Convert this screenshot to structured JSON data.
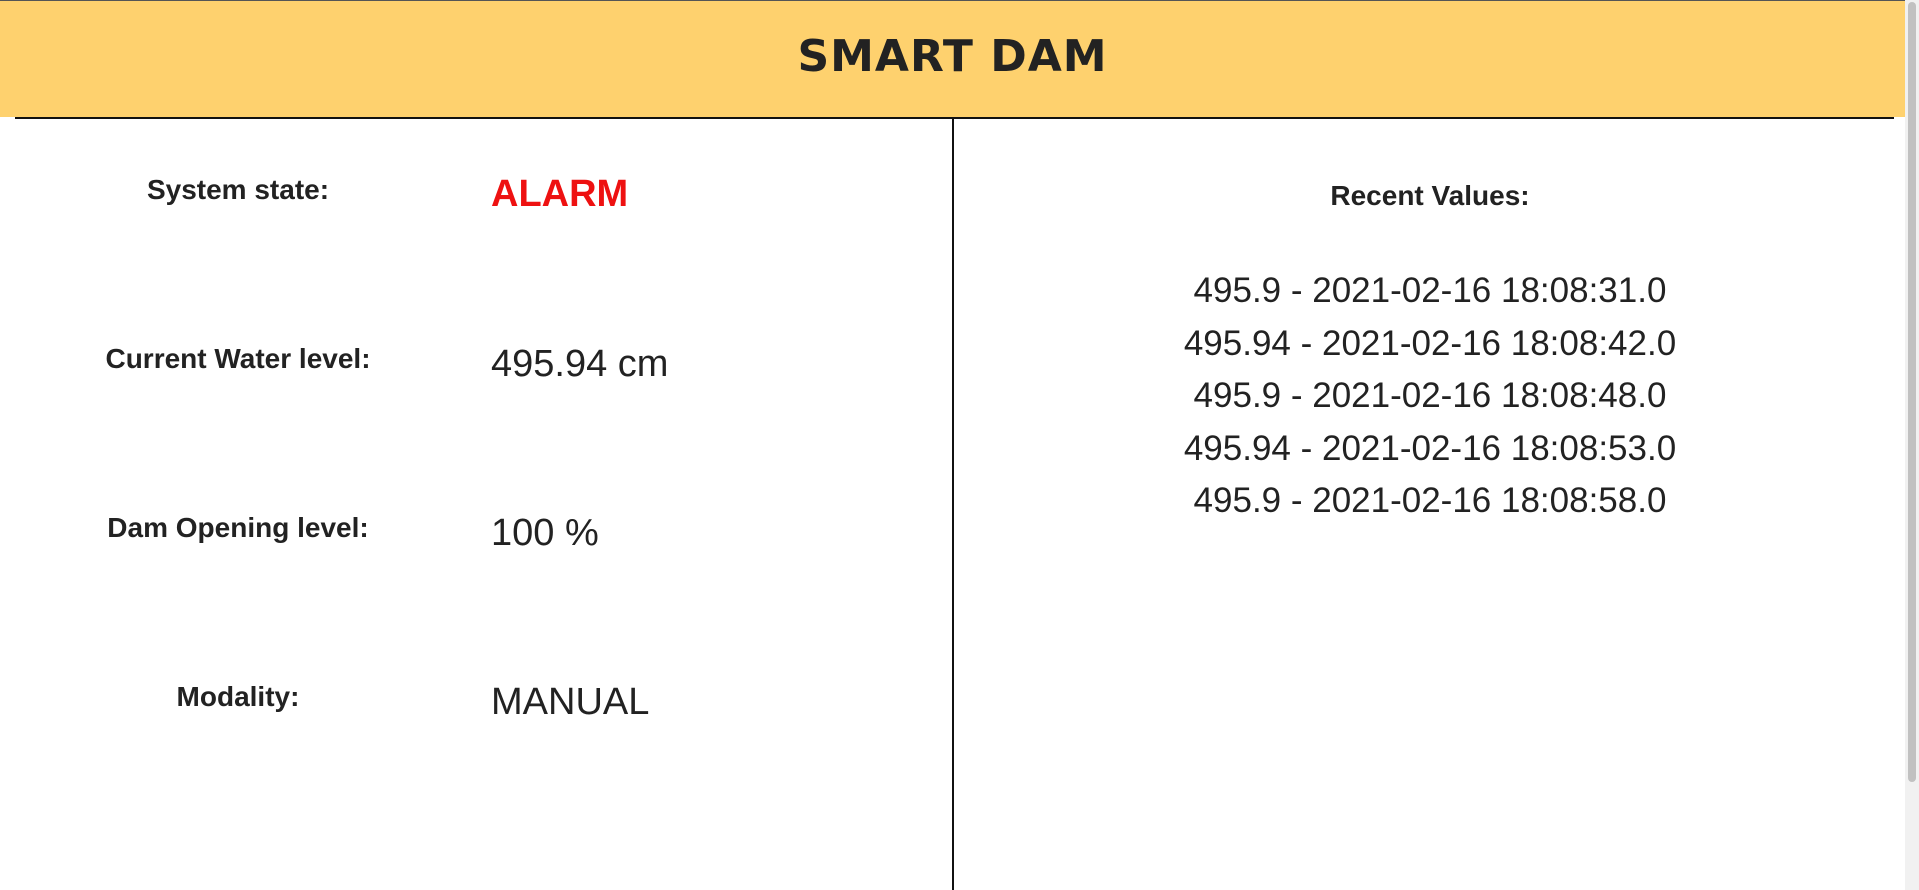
{
  "header": {
    "title": "SMART DAM"
  },
  "status": {
    "system_state_label": "System state:",
    "system_state_value": "ALARM",
    "water_level_label": "Current Water level:",
    "water_level_value": "495.94 cm",
    "dam_opening_label": "Dam Opening level:",
    "dam_opening_value": "100 %",
    "modality_label": "Modality:",
    "modality_value": "MANUAL"
  },
  "recent": {
    "title": "Recent Values:",
    "items": [
      "495.9 - 2021-02-16 18:08:31.0",
      "495.94 - 2021-02-16 18:08:42.0",
      "495.9 - 2021-02-16 18:08:48.0",
      "495.94 - 2021-02-16 18:08:53.0",
      "495.9 - 2021-02-16 18:08:58.0"
    ]
  },
  "colors": {
    "header_bg": "#fed16e",
    "alarm": "#ee1111",
    "text": "#222222"
  }
}
